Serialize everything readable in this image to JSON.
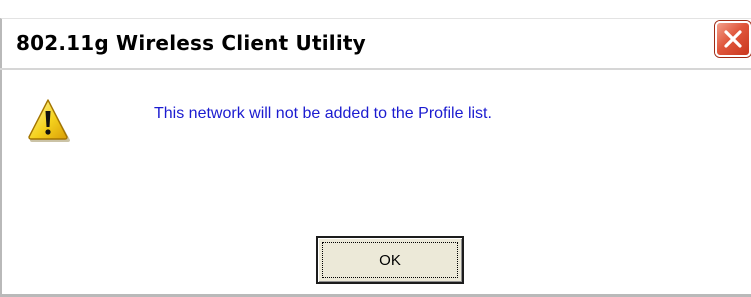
{
  "window": {
    "title": "802.11g Wireless Client Utility",
    "close_icon": "close-icon"
  },
  "message": {
    "icon": "warning-icon",
    "text": "This network will not be added to the Profile list."
  },
  "buttons": {
    "ok_label": "OK"
  },
  "colors": {
    "message_text": "#1b1bd0",
    "close_button": "#e0573d",
    "warning_yellow": "#f5d21d"
  }
}
